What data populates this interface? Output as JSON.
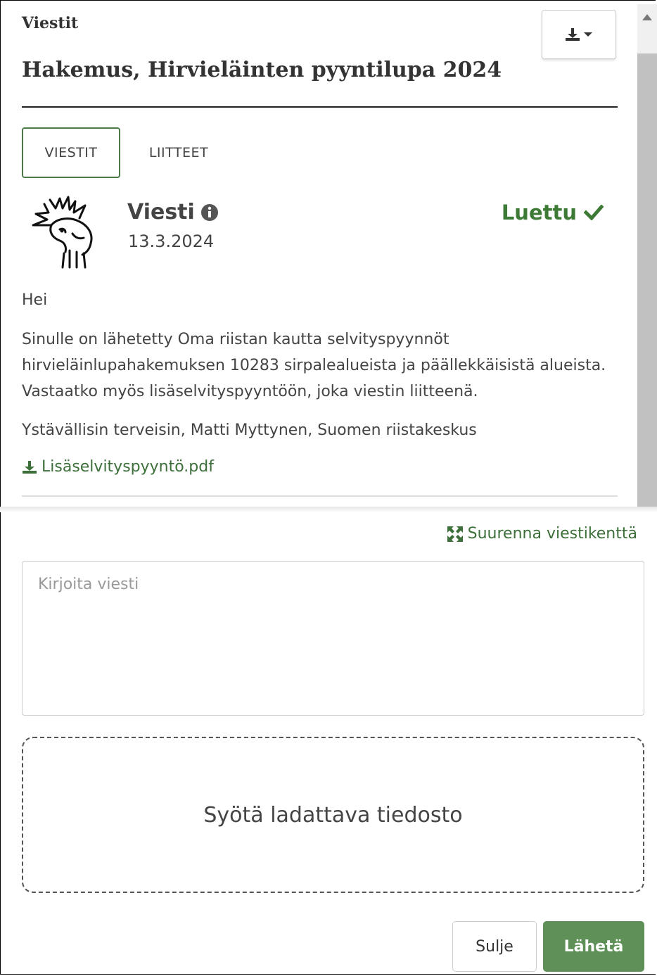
{
  "header": {
    "section_label": "Viestit",
    "title": "Hakemus, Hirvieläinten pyyntilupa 2024"
  },
  "tabs": [
    {
      "label": "VIESTIT",
      "active": true
    },
    {
      "label": "LIITTEET",
      "active": false
    }
  ],
  "message": {
    "title": "Viesti",
    "date": "13.3.2024",
    "status": "Luettu",
    "greeting": "Hei",
    "body": "Sinulle on lähetetty Oma riistan kautta selvityspyynnöt hirvieläinlupahakemuksen 10283 sirpalealueista ja päällekkäisistä alueista. Vastaatko myös lisäselvityspyyntöön, joka viestin liitteenä.",
    "signature": "Ystävällisin terveisin, Matti Myttynen, Suomen riistakeskus",
    "attachment": "Lisäselvityspyyntö.pdf"
  },
  "composer": {
    "expand_label": "Suurenna viestikenttä",
    "placeholder": "Kirjoita viesti",
    "dropzone_label": "Syötä ladattava tiedosto",
    "close_label": "Sulje",
    "send_label": "Lähetä"
  },
  "colors": {
    "accent_green": "#3d7a36",
    "send_button": "#5e9058"
  },
  "icons": [
    "download-icon",
    "caret-down-icon",
    "moose-logo-icon",
    "info-icon",
    "check-icon",
    "expand-icon"
  ]
}
